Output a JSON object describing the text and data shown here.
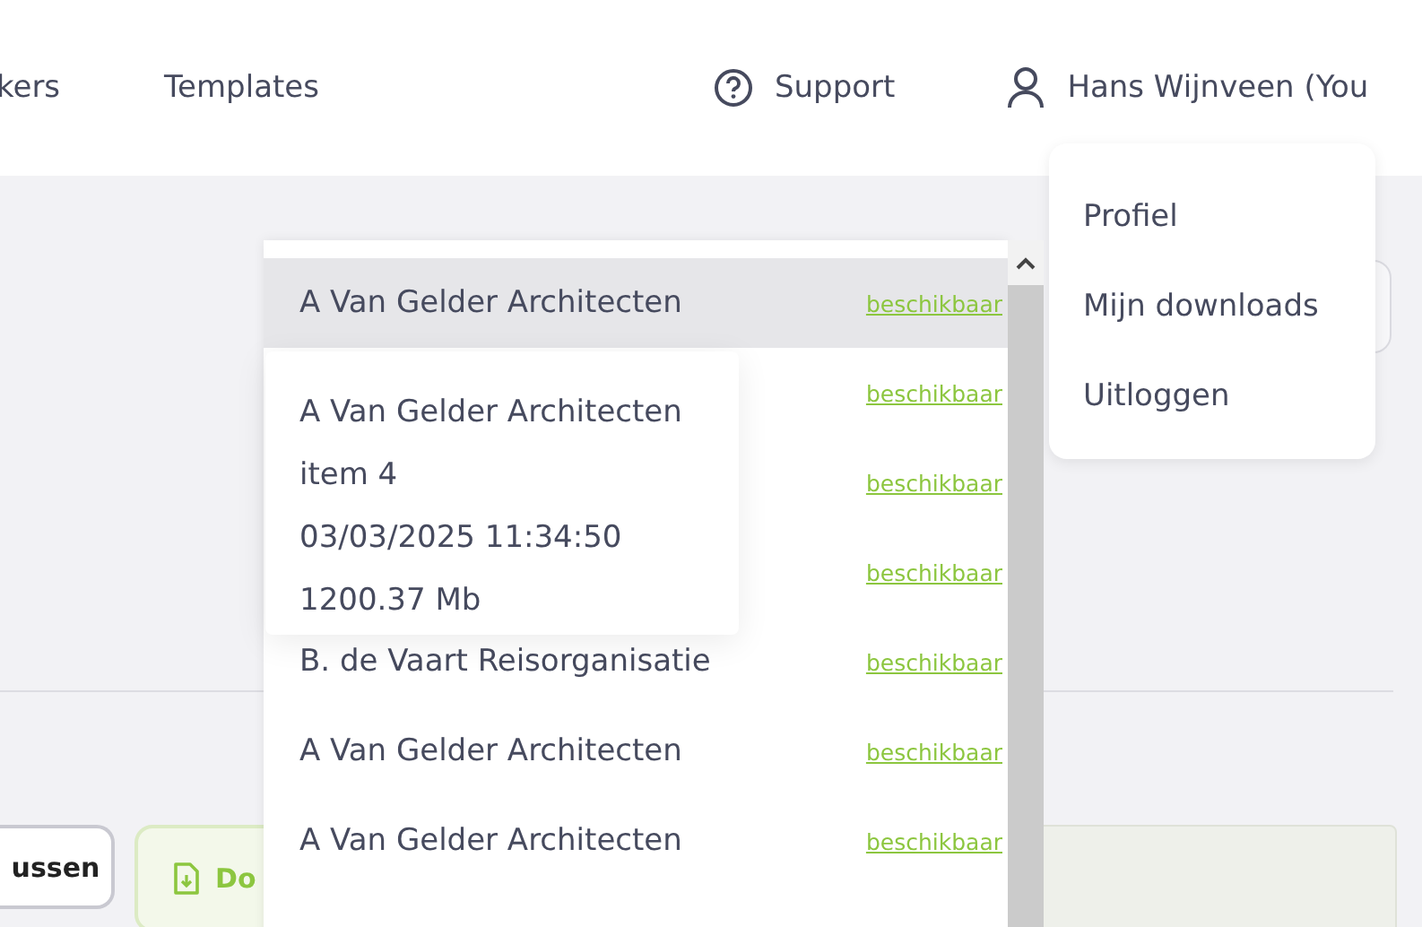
{
  "nav": {
    "items": [
      "kers",
      "Templates"
    ],
    "support": "Support",
    "user": "Hans Wijnveen (You"
  },
  "account_menu": {
    "items": [
      "Profiel",
      "Mijn downloads",
      "Uitloggen"
    ]
  },
  "page": {
    "buttons": [
      {
        "label": "ussen",
        "kind": "outline"
      },
      {
        "label": "Do",
        "kind": "download"
      }
    ]
  },
  "download_list": {
    "rows": [
      {
        "name": "A Van Gelder Architecten",
        "status": "beschikbaar",
        "selected": true
      },
      {
        "status": "beschikbaar",
        "selected": false
      },
      {
        "status": "beschikbaar",
        "selected": false
      },
      {
        "status": "beschikbaar",
        "selected": false
      },
      {
        "name": "B. de Vaart Reisorganisatie",
        "status": "beschikbaar",
        "selected": false
      },
      {
        "name": "A Van Gelder Architecten",
        "status": "beschikbaar",
        "selected": false
      },
      {
        "name": "A Van Gelder Architecten",
        "status": "beschikbaar",
        "selected": false
      }
    ],
    "tooltip": {
      "lines": [
        "A Van Gelder Architecten",
        "item 4",
        "03/03/2025 11:34:50",
        "1200.37 Mb"
      ]
    }
  }
}
